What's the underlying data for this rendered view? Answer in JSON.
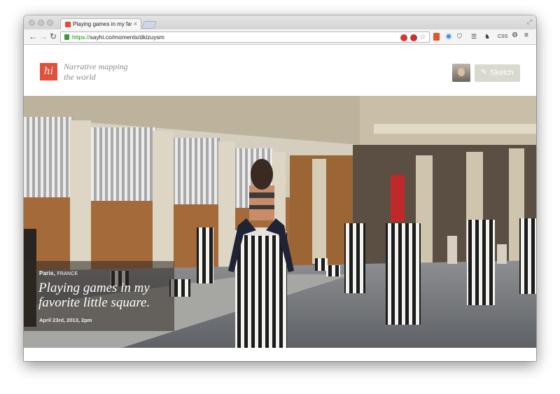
{
  "browser": {
    "tab_title": "Playing games in my favori",
    "tab_close": "×",
    "url_scheme": "https://",
    "url_rest": "sayhi.co/moments/dkizuysm",
    "ext_css_label": "CSS"
  },
  "site": {
    "logo_text": "hi",
    "tagline_line1": "Narrative mapping",
    "tagline_line2": "the world",
    "sketch_label": "Sketch"
  },
  "moment": {
    "city": "Paris,",
    "country": "FRANCE",
    "title": "Playing games in my favorite little square.",
    "date": "April 23rd, 2013, 2pm"
  },
  "colors": {
    "brand": "#e2503a",
    "secure": "#1a8a1a",
    "sketch_button": "#d9d9d0"
  }
}
